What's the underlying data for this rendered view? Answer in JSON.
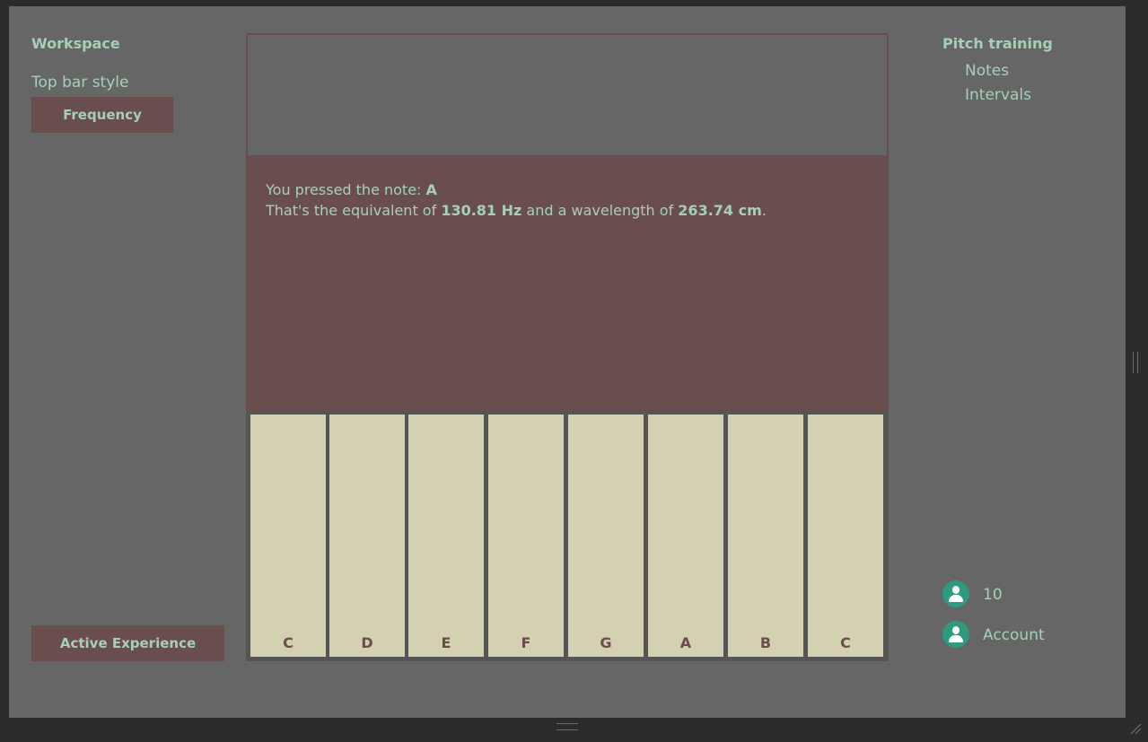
{
  "left_sidebar": {
    "title": "Workspace",
    "top_bar_style_label": "Top bar style",
    "frequency_button": "Frequency",
    "active_experience_button": "Active Experience"
  },
  "info": {
    "pressed_prefix": "You pressed the note: ",
    "pressed_note": "A",
    "equiv_prefix": "That's the equivalent of ",
    "frequency": "130.81 Hz",
    "wavelength_prefix": " and a wavelength of ",
    "wavelength": "263.74 cm",
    "suffix": "."
  },
  "keyboard": {
    "keys": [
      "C",
      "D",
      "E",
      "F",
      "G",
      "A",
      "B",
      "C"
    ]
  },
  "right_sidebar": {
    "title": "Pitch training",
    "items": [
      "Notes",
      "Intervals"
    ],
    "count": "10",
    "account_label": "Account"
  },
  "colors": {
    "background": "#666666",
    "accent": "#6a4e4e",
    "text": "#a6d0b6",
    "key": "#d4d0b2",
    "avatar": "#2e9a80"
  },
  "icons": [
    "user-icon",
    "account-icon",
    "drag-handle-icon",
    "resize-grip-icon"
  ]
}
